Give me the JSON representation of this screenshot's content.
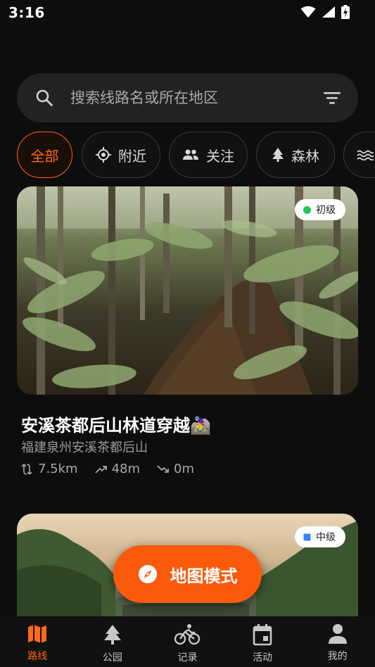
{
  "status_bar": {
    "time": "3:16"
  },
  "search": {
    "placeholder": "搜索线路名或所在地区"
  },
  "chips": [
    {
      "label": "全部",
      "icon": "none",
      "active": true
    },
    {
      "label": "附近",
      "icon": "location-target-icon",
      "active": false
    },
    {
      "label": "关注",
      "icon": "people-icon",
      "active": false
    },
    {
      "label": "森林",
      "icon": "tree-icon",
      "active": false
    },
    {
      "label": "",
      "icon": "waves-icon",
      "active": false
    }
  ],
  "routes": [
    {
      "title": "安溪茶都后山林道穿越🚵‍♀",
      "location": "福建泉州安溪茶都后山",
      "distance": "7.5km",
      "ascent": "48m",
      "descent": "0m",
      "difficulty": "初级",
      "difficulty_color": "#22c55e"
    },
    {
      "difficulty": "中级",
      "difficulty_color": "#3b82f6"
    }
  ],
  "map_button": {
    "label": "地图模式",
    "icon": "compass-icon"
  },
  "bottom_nav": [
    {
      "label": "路线",
      "icon": "map-icon",
      "active": true
    },
    {
      "label": "公园",
      "icon": "tree-icon",
      "active": false
    },
    {
      "label": "记录",
      "icon": "bike-icon",
      "active": false
    },
    {
      "label": "活动",
      "icon": "calendar-icon",
      "active": false
    },
    {
      "label": "我的",
      "icon": "person-icon",
      "active": false
    }
  ],
  "colors": {
    "accent": "#fb5a0c",
    "background": "#0d0d0d",
    "surface": "#222222"
  }
}
